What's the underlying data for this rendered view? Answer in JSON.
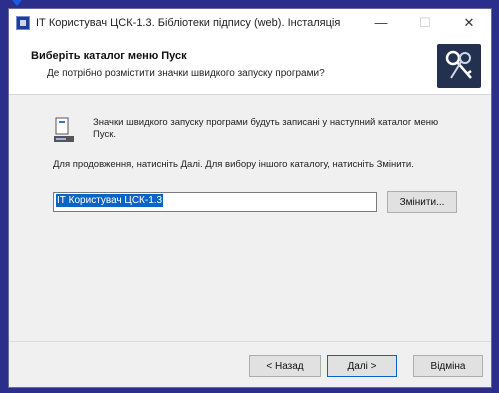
{
  "window": {
    "title": "ІТ Користувач ЦСК-1.3. Бібліотеки підпису (web). Інсталяція",
    "minimize_icon": "minimize-icon",
    "maximize_icon": "maximize-icon",
    "close_icon": "close-icon"
  },
  "header": {
    "title": "Виберіть каталог меню Пуск",
    "subtitle": "Де потрібно розмістити значки швидкого запуску програми?",
    "logo_icon": "keys-icon"
  },
  "content": {
    "info_text": "Значки швидкого запуску програми будуть записані у наступний каталог меню Пуск.",
    "continue_text": "Для продовження, натисніть Далі. Для вибору іншого каталогу, натисніть Змінити.",
    "folder_value": "ІТ Користувач ЦСК-1.3",
    "browse_label": "Змінити..."
  },
  "footer": {
    "back_label": "< Назад",
    "next_label": "Далі >",
    "cancel_label": "Відміна"
  },
  "colors": {
    "accent": "#0a64c8",
    "frame": "#2b2e8a"
  }
}
